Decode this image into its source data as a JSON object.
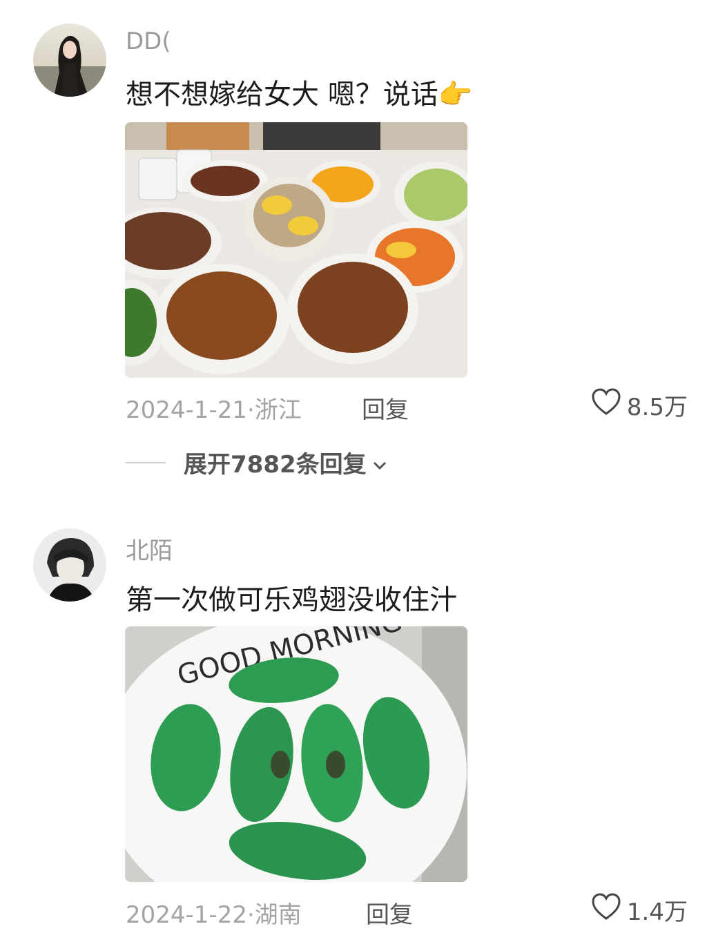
{
  "comments": [
    {
      "username": "DD(",
      "text": "想不想嫁给女大 嗯？说话",
      "emoji": "👉",
      "date": "2024-1-21",
      "location": "浙江",
      "reply_label": "回复",
      "likes": "8.5万",
      "expand_label": "展开7882条回复"
    },
    {
      "username": "北陌",
      "text": "第一次做可乐鸡翅没收住汁",
      "date": "2024-1-22",
      "location": "湖南",
      "reply_label": "回复",
      "likes": "1.4万",
      "plate_text": "GOOD MORNING"
    }
  ],
  "colors": {
    "meta_gray": "#a3a3a3",
    "username_gray": "#9a9a9a",
    "action_gray": "#555555"
  },
  "icons": [
    "heart-icon",
    "chevron-down-icon",
    "pointing-hand-emoji"
  ]
}
